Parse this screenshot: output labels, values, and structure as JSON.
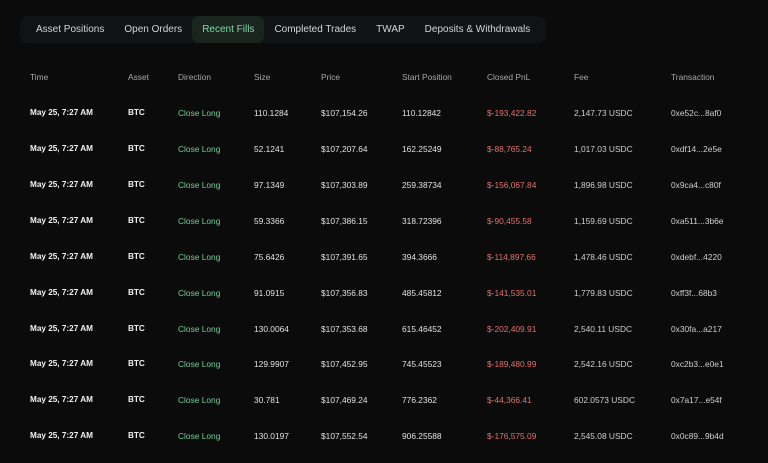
{
  "tabs": [
    {
      "label": "Asset Positions",
      "active": false
    },
    {
      "label": "Open Orders",
      "active": false
    },
    {
      "label": "Recent Fills",
      "active": true
    },
    {
      "label": "Completed Trades",
      "active": false
    },
    {
      "label": "TWAP",
      "active": false
    },
    {
      "label": "Deposits & Withdrawals",
      "active": false
    }
  ],
  "table": {
    "headers": {
      "time": "Time",
      "asset": "Asset",
      "direction": "Direction",
      "size": "Size",
      "price": "Price",
      "start_position": "Start Position",
      "closed_pnl": "Closed PnL",
      "fee": "Fee",
      "transaction": "Transaction"
    },
    "rows": [
      {
        "time": "May 25, 7:27 AM",
        "asset": "BTC",
        "direction": "Close Long",
        "size": "110.1284",
        "price": "$107,154.26",
        "start_position": "110.12842",
        "closed_pnl": "$-193,422.82",
        "fee": "2,147.73 USDC",
        "transaction": "0xe52c...8af0"
      },
      {
        "time": "May 25, 7:27 AM",
        "asset": "BTC",
        "direction": "Close Long",
        "size": "52.1241",
        "price": "$107,207.64",
        "start_position": "162.25249",
        "closed_pnl": "$-88,765.24",
        "fee": "1,017.03 USDC",
        "transaction": "0xdf14...2e5e"
      },
      {
        "time": "May 25, 7:27 AM",
        "asset": "BTC",
        "direction": "Close Long",
        "size": "97.1349",
        "price": "$107,303.89",
        "start_position": "259.38734",
        "closed_pnl": "$-156,067.84",
        "fee": "1,896.98 USDC",
        "transaction": "0x9ca4...c80f"
      },
      {
        "time": "May 25, 7:27 AM",
        "asset": "BTC",
        "direction": "Close Long",
        "size": "59.3366",
        "price": "$107,386.15",
        "start_position": "318.72396",
        "closed_pnl": "$-90,455.58",
        "fee": "1,159.69 USDC",
        "transaction": "0xa511...3b6e"
      },
      {
        "time": "May 25, 7:27 AM",
        "asset": "BTC",
        "direction": "Close Long",
        "size": "75.6426",
        "price": "$107,391.65",
        "start_position": "394.3666",
        "closed_pnl": "$-114,897.66",
        "fee": "1,478.46 USDC",
        "transaction": "0xdebf...4220"
      },
      {
        "time": "May 25, 7:27 AM",
        "asset": "BTC",
        "direction": "Close Long",
        "size": "91.0915",
        "price": "$107,356.83",
        "start_position": "485.45812",
        "closed_pnl": "$-141,535.01",
        "fee": "1,779.83 USDC",
        "transaction": "0xff3f...68b3"
      },
      {
        "time": "May 25, 7:27 AM",
        "asset": "BTC",
        "direction": "Close Long",
        "size": "130.0064",
        "price": "$107,353.68",
        "start_position": "615.46452",
        "closed_pnl": "$-202,409.91",
        "fee": "2,540.11 USDC",
        "transaction": "0x30fa...a217"
      },
      {
        "time": "May 25, 7:27 AM",
        "asset": "BTC",
        "direction": "Close Long",
        "size": "129.9907",
        "price": "$107,452.95",
        "start_position": "745.45523",
        "closed_pnl": "$-189,480.99",
        "fee": "2,542.16 USDC",
        "transaction": "0xc2b3...e0e1"
      },
      {
        "time": "May 25, 7:27 AM",
        "asset": "BTC",
        "direction": "Close Long",
        "size": "30.781",
        "price": "$107,469.24",
        "start_position": "776.2362",
        "closed_pnl": "$-44,366.41",
        "fee": "602.0573 USDC",
        "transaction": "0x7a17...e54f"
      },
      {
        "time": "May 25, 7:27 AM",
        "asset": "BTC",
        "direction": "Close Long",
        "size": "130.0197",
        "price": "$107,552.54",
        "start_position": "906.25588",
        "closed_pnl": "$-176,575.09",
        "fee": "2,545.08 USDC",
        "transaction": "0x0c89...9b4d"
      }
    ]
  },
  "colors": {
    "background": "#0b0b0c",
    "tab_active_bg": "#1a2520",
    "tab_active_text": "#7fd8a6",
    "direction_long": "#6fcf97",
    "pnl_negative": "#e2726c"
  }
}
